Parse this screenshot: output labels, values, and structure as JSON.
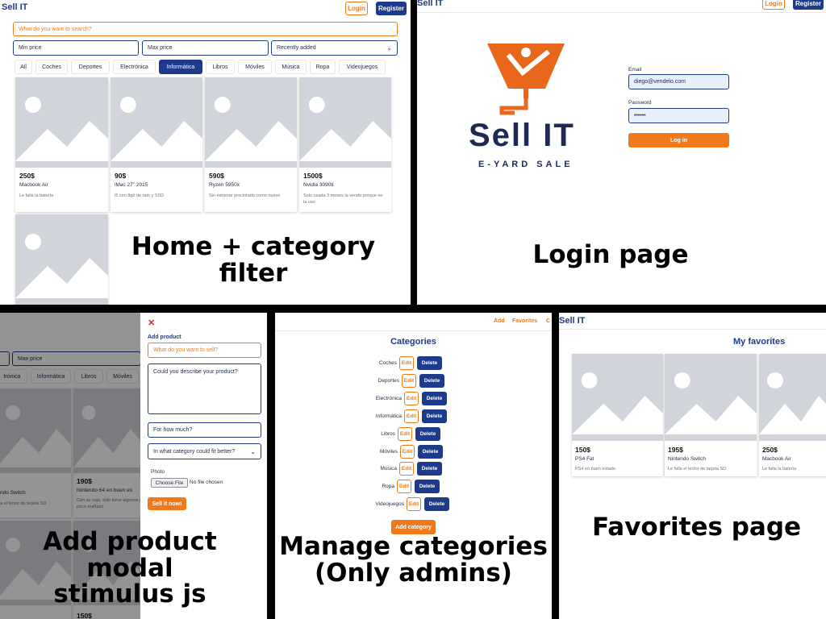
{
  "colors": {
    "brand_blue": "#1e3a8a",
    "accent_orange": "#f07a1b",
    "placeholder_grey": "#d1d5db"
  },
  "home": {
    "brand": "Sell IT",
    "login": "Login",
    "register": "Register",
    "search_placeholder": "What do you want to search?",
    "min_price": "Min price",
    "max_price": "Max price",
    "sort": "Recently added",
    "tabs": [
      "All",
      "Coches",
      "Deportes",
      "Electrónica",
      "Informática",
      "Libros",
      "Móviles",
      "Música",
      "Ropa",
      "Videojuegos"
    ],
    "active_tab": "Informática",
    "products": [
      {
        "price": "250$",
        "name": "Macbook Air",
        "desc": "Le falla la batería"
      },
      {
        "price": "90$",
        "name": "iMac 27\" 2015",
        "desc": "i5 con 8gb de ram y SSD"
      },
      {
        "price": "590$",
        "name": "Ryzen 5950x",
        "desc": "Sin estrenar precintado como nuevo"
      },
      {
        "price": "1500$",
        "name": "Nvidia 3090ti",
        "desc": "Solo usada 3 meses la vendo porque no la uso"
      }
    ],
    "caption": "Home + category filter"
  },
  "login": {
    "brand": "Sell IT",
    "login": "Login",
    "register": "Register",
    "logo_title": "Sell IT",
    "logo_sub": "E-YARD SALE",
    "email_label": "Email",
    "email_value": "diego@vendelo.com",
    "password_label": "Password",
    "password_value": "••••••",
    "submit": "Log in",
    "caption": "Login page"
  },
  "modal": {
    "bg_max_price": "Max price",
    "bg_tabs": [
      "trónica",
      "Informática",
      "Libros",
      "Móviles"
    ],
    "bg_products": [
      {
        "price": "",
        "name": "ndo Switch",
        "desc": "a el lector de tarjeta SD"
      },
      {
        "price": "190$",
        "name": "Nintendo 64 en buen es",
        "desc": "Con su caja, solo tiene algunos p\npoco arañazo"
      }
    ],
    "bg_bottom_price": "150$",
    "close": "✕",
    "title": "Add product",
    "title_placeholder": "What do you want to sell?",
    "desc_placeholder": "Could you describe your product?",
    "price_placeholder": "For how much?",
    "category_placeholder": "In what category could fit better?",
    "photo_label": "Photo",
    "choose_file": "Choose File",
    "no_file": "No file chosen",
    "submit": "Sell it now!",
    "caption_line1": "Add product modal",
    "caption_line2": "stimulus js"
  },
  "manage": {
    "nav": [
      "Add",
      "Favorites",
      "C"
    ],
    "title": "Categories",
    "edit": "Edit",
    "delete": "Delete",
    "categories": [
      "Coches",
      "Deportes",
      "Electrónica",
      "Informática",
      "Libros",
      "Móviles",
      "Música",
      "Ropa",
      "Videojuegos"
    ],
    "add": "Add category",
    "caption_line1": "Manage categories",
    "caption_line2": "(Only admins)"
  },
  "favorites": {
    "brand": "Sell IT",
    "title": "My favorites",
    "products": [
      {
        "price": "150$",
        "name": "PS4 Fat",
        "desc": "PS4 en buen estado"
      },
      {
        "price": "195$",
        "name": "Nintendo Switch",
        "desc": "Le falla el lector de tarjeta SD"
      },
      {
        "price": "250$",
        "name": "Macbook Air",
        "desc": "Le falla la batería"
      }
    ],
    "caption": "Favorites page"
  }
}
